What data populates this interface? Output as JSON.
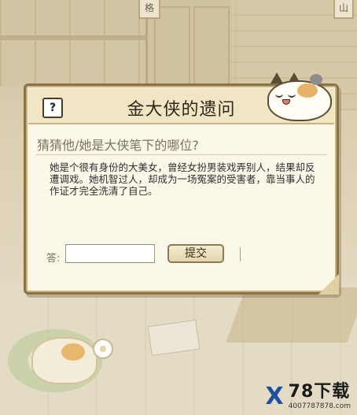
{
  "background": {
    "sign_left": "格",
    "sign_right": "山"
  },
  "dialog": {
    "help_label": "?",
    "title": "金大侠的遗问",
    "question": "猜猜他/她是大侠笔下的哪位?",
    "hint": "她是个很有身份的大美女，曾经女扮男装戏弄别人，结果却反遭调戏。她机智过人，却成为一场冤案的受害者，靠当事人的作证才完全洗清了自己。",
    "answer_label": "答:",
    "answer_value": "",
    "submit_label": "提交"
  },
  "watermark": {
    "logo": "X",
    "title": "78下载",
    "url": "4007787878.com"
  },
  "colors": {
    "dialog_border": "#8a7349",
    "dialog_bg": "#fbf7e9",
    "header_bg": "#f1e6c4",
    "watermark_blue": "#1f4fa0"
  }
}
